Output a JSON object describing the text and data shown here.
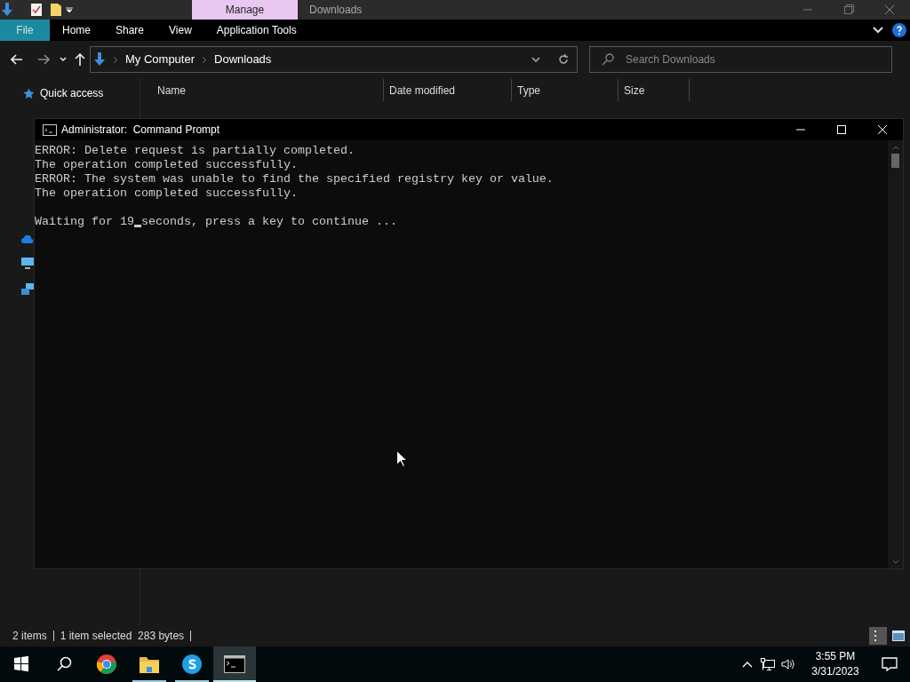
{
  "explorer": {
    "context_tab": "Manage",
    "title": "Downloads",
    "ribbon_tabs": [
      {
        "label": "File",
        "selected": true
      },
      {
        "label": "Home",
        "selected": false
      },
      {
        "label": "Share",
        "selected": false
      },
      {
        "label": "View",
        "selected": false
      },
      {
        "label": "Application Tools",
        "selected": false
      }
    ],
    "breadcrumb": [
      "My Computer",
      "Downloads"
    ],
    "search": {
      "placeholder": "Search Downloads"
    },
    "nav": [
      {
        "label": "Quick access"
      }
    ],
    "columns": [
      "Name",
      "Date modified",
      "Type",
      "Size"
    ],
    "status": [
      "2 items",
      "1 item selected  283 bytes"
    ]
  },
  "console": {
    "title": "Administrator:  Command Prompt",
    "lines": [
      "ERROR: Delete request is partially completed.",
      "The operation completed successfully.",
      "ERROR: The system was unable to find the specified registry key or value.",
      "The operation completed successfully."
    ],
    "prompt": {
      "before": "Waiting for 19",
      "after": "seconds, press a key to continue ..."
    }
  },
  "taskbar": {
    "apps": [
      {
        "kind": "chrome",
        "running": false,
        "selected": false
      },
      {
        "kind": "folder",
        "running": true,
        "selected": false
      },
      {
        "kind": "skype",
        "running": true,
        "selected": false
      },
      {
        "kind": "console",
        "running": true,
        "selected": true
      }
    ],
    "time": "3:55 PM",
    "date": "3/31/2023"
  }
}
